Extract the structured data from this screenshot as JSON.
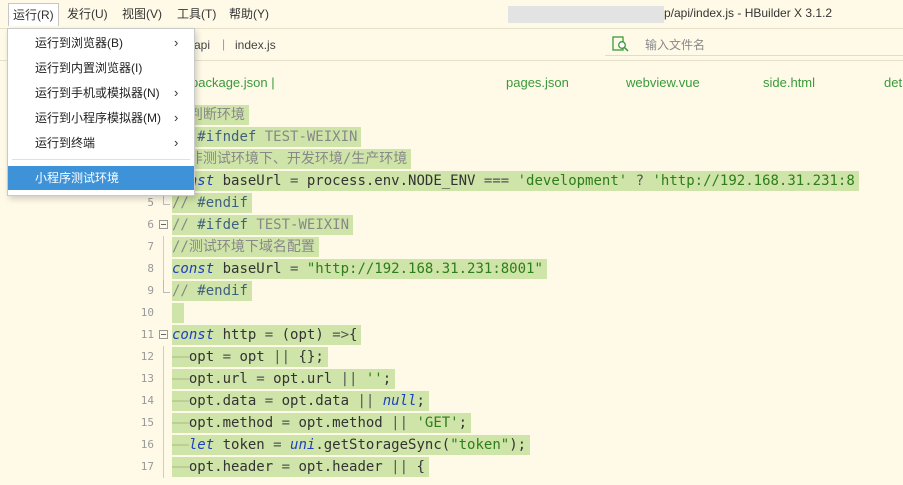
{
  "window": {
    "title": "p/api/index.js - HBuilder X 3.1.2"
  },
  "menubar": {
    "items": [
      {
        "label": "运行(R)"
      },
      {
        "label": "发行(U)"
      },
      {
        "label": "视图(V)"
      },
      {
        "label": "工具(T)"
      },
      {
        "label": "帮助(Y)"
      }
    ]
  },
  "dropdown": {
    "items": [
      {
        "label": "运行到浏览器(B)",
        "submenu": "›"
      },
      {
        "label": "运行到内置浏览器(I)"
      },
      {
        "label": "运行到手机或模拟器(N)",
        "submenu": "›"
      },
      {
        "label": "运行到小程序模拟器(M)",
        "submenu": "›"
      },
      {
        "label": "运行到终端",
        "submenu": "›"
      },
      {
        "label": "小程序测试环境"
      }
    ]
  },
  "pathbar": {
    "crumbs": [
      "api",
      "index.js"
    ],
    "separator": "|",
    "search_placeholder": "输入文件名"
  },
  "filetabs": [
    "package.json |",
    "pages.json",
    "webview.vue",
    "side.html",
    "det"
  ],
  "editor": {
    "lines": [
      {
        "n": "",
        "tokens": [
          [
            "cm",
            "//判断环境"
          ]
        ]
      },
      {
        "n": "",
        "tokens": [
          [
            "cm",
            "// "
          ],
          [
            "pre",
            "#ifndef "
          ],
          [
            "cm",
            "TEST-WEIXIN"
          ]
        ]
      },
      {
        "n": "",
        "tokens": [
          [
            "cm",
            "//非测试环境下、开发环境/生产环境"
          ]
        ]
      },
      {
        "n": "",
        "tokens": [
          [
            "kw",
            "const"
          ],
          [
            "id",
            " baseUrl "
          ],
          [
            "op",
            "="
          ],
          [
            "id",
            " process.env.NODE_ENV "
          ],
          [
            "op",
            "==="
          ],
          [
            "str",
            " 'development'"
          ],
          [
            "op",
            " ? "
          ],
          [
            "str",
            "'http://192.168.31.231:8"
          ]
        ]
      },
      {
        "n": "5",
        "tokens": [
          [
            "cm",
            "// "
          ],
          [
            "pre",
            "#endif"
          ]
        ]
      },
      {
        "n": "6",
        "tokens": [
          [
            "cm",
            "// "
          ],
          [
            "pre",
            "#ifdef "
          ],
          [
            "cm",
            "TEST-WEIXIN"
          ]
        ]
      },
      {
        "n": "7",
        "tokens": [
          [
            "cm",
            "//测试环境下域名配置"
          ]
        ]
      },
      {
        "n": "8",
        "tokens": [
          [
            "kw",
            "const"
          ],
          [
            "id",
            " baseUrl "
          ],
          [
            "op",
            "="
          ],
          [
            "str",
            " \"http://192.168.31.231:8001\""
          ]
        ]
      },
      {
        "n": "9",
        "tokens": [
          [
            "cm",
            "// "
          ],
          [
            "pre",
            "#endif"
          ]
        ]
      },
      {
        "n": "10",
        "tokens": [
          [
            "id",
            " "
          ]
        ]
      },
      {
        "n": "11",
        "tokens": [
          [
            "kw",
            "const"
          ],
          [
            "id",
            " http "
          ],
          [
            "op",
            "="
          ],
          [
            "id",
            " (opt) "
          ],
          [
            "op",
            "=>"
          ],
          [
            "id",
            "{"
          ]
        ]
      },
      {
        "n": "12",
        "tokens": [
          [
            "indent-guide",
            "——"
          ],
          [
            "id",
            "opt "
          ],
          [
            "op",
            "="
          ],
          [
            "id",
            " opt "
          ],
          [
            "op",
            "||"
          ],
          [
            "id",
            " {};"
          ]
        ]
      },
      {
        "n": "13",
        "tokens": [
          [
            "indent-guide",
            "——"
          ],
          [
            "id",
            "opt.url "
          ],
          [
            "op",
            "="
          ],
          [
            "id",
            " opt.url "
          ],
          [
            "op",
            "||"
          ],
          [
            "str",
            " ''"
          ],
          [
            "id",
            ";"
          ]
        ]
      },
      {
        "n": "14",
        "tokens": [
          [
            "indent-guide",
            "——"
          ],
          [
            "id",
            "opt.data "
          ],
          [
            "op",
            "="
          ],
          [
            "id",
            " opt.data "
          ],
          [
            "op",
            "||"
          ],
          [
            "kw",
            " null"
          ],
          [
            "id",
            ";"
          ]
        ]
      },
      {
        "n": "15",
        "tokens": [
          [
            "indent-guide",
            "——"
          ],
          [
            "id",
            "opt.method "
          ],
          [
            "op",
            "="
          ],
          [
            "id",
            " opt.method "
          ],
          [
            "op",
            "||"
          ],
          [
            "str",
            " 'GET'"
          ],
          [
            "id",
            ";"
          ]
        ]
      },
      {
        "n": "16",
        "tokens": [
          [
            "indent-guide",
            "——"
          ],
          [
            "kw",
            "let"
          ],
          [
            "id",
            " token "
          ],
          [
            "op",
            "="
          ],
          [
            "kw",
            " uni"
          ],
          [
            "id",
            ".getStorageSync("
          ],
          [
            "str",
            "\"token\""
          ],
          [
            "id",
            ");"
          ]
        ]
      },
      {
        "n": "17",
        "tokens": [
          [
            "indent-guide",
            "——"
          ],
          [
            "id",
            "opt.header "
          ],
          [
            "op",
            "="
          ],
          [
            "id",
            " opt.header "
          ],
          [
            "op",
            "||"
          ],
          [
            "id",
            " {"
          ]
        ]
      }
    ]
  },
  "colors": {
    "background": "#fffae8",
    "selection": "#cfe4a8",
    "menu_highlight": "#3e92d8",
    "filetab": "#3a9a3a"
  }
}
